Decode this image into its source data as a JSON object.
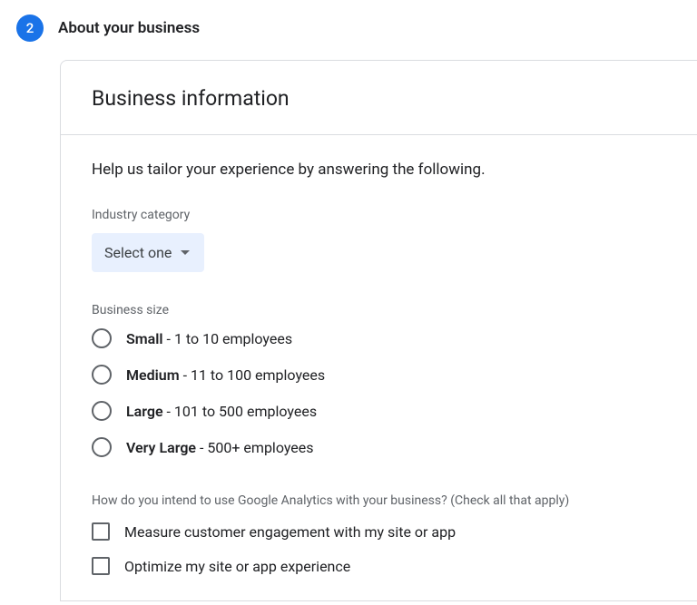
{
  "step": {
    "number": "2",
    "title": "About your business"
  },
  "card": {
    "title": "Business information",
    "intro": "Help us tailor your experience by answering the following."
  },
  "industry": {
    "label": "Industry category",
    "selected": "Select one"
  },
  "business_size": {
    "label": "Business size",
    "options": [
      {
        "bold": "Small",
        "rest": " - 1 to 10 employees"
      },
      {
        "bold": "Medium",
        "rest": " - 11 to 100 employees"
      },
      {
        "bold": "Large",
        "rest": " - 101 to 500 employees"
      },
      {
        "bold": "Very Large",
        "rest": " - 500+ employees"
      }
    ]
  },
  "intent": {
    "label": "How do you intend to use Google Analytics with your business? (Check all that apply)",
    "options": [
      "Measure customer engagement with my site or app",
      "Optimize my site or app experience"
    ]
  }
}
